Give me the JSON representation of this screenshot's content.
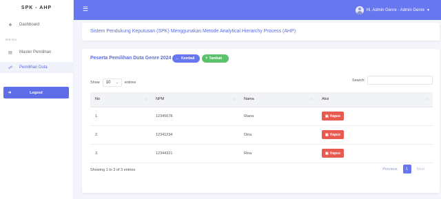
{
  "sidebar": {
    "brand": "SPK - AHP",
    "items": [
      {
        "label": "Dashboard",
        "icon": "home-icon"
      },
      {
        "label": "Master Pemilihan",
        "icon": "chart-icon"
      },
      {
        "label": "Pemilihan Duta",
        "icon": "link-icon"
      }
    ],
    "menu_heading": "MENU",
    "logout_label": "Logout"
  },
  "topbar": {
    "greeting": "Hi, Admin Genre - Admin Genre"
  },
  "header_card": {
    "title": "Sistem Pendukung Keputusan (SPK) Menggunakan Metode Analytical Hierarchy Process (AHP)"
  },
  "main": {
    "title": "Peserta Pemilihan Duta Genre 2024",
    "back_label": "Kembali",
    "add_label": "Tambah",
    "show_label": "Show",
    "entries_value": "10",
    "entries_label": "entries",
    "search_label": "Search:",
    "columns": [
      "No",
      "NPM",
      "Nama",
      "Aksi"
    ],
    "rows": [
      {
        "no": "1.",
        "npm": "12345678",
        "nama": "Riana",
        "action": "Hapus"
      },
      {
        "no": "2.",
        "npm": "12341234",
        "nama": "Dina",
        "action": "Hapus"
      },
      {
        "no": "3.",
        "npm": "12344321",
        "nama": "Rina",
        "action": "Hapus"
      }
    ],
    "info": "Showing 1 to 3 of 3 entries",
    "pagination": {
      "previous": "Previous",
      "current": "1",
      "next": "Next"
    }
  },
  "colors": {
    "primary": "#6777ef",
    "success": "#5bc26b",
    "danger": "#e85a4f"
  }
}
